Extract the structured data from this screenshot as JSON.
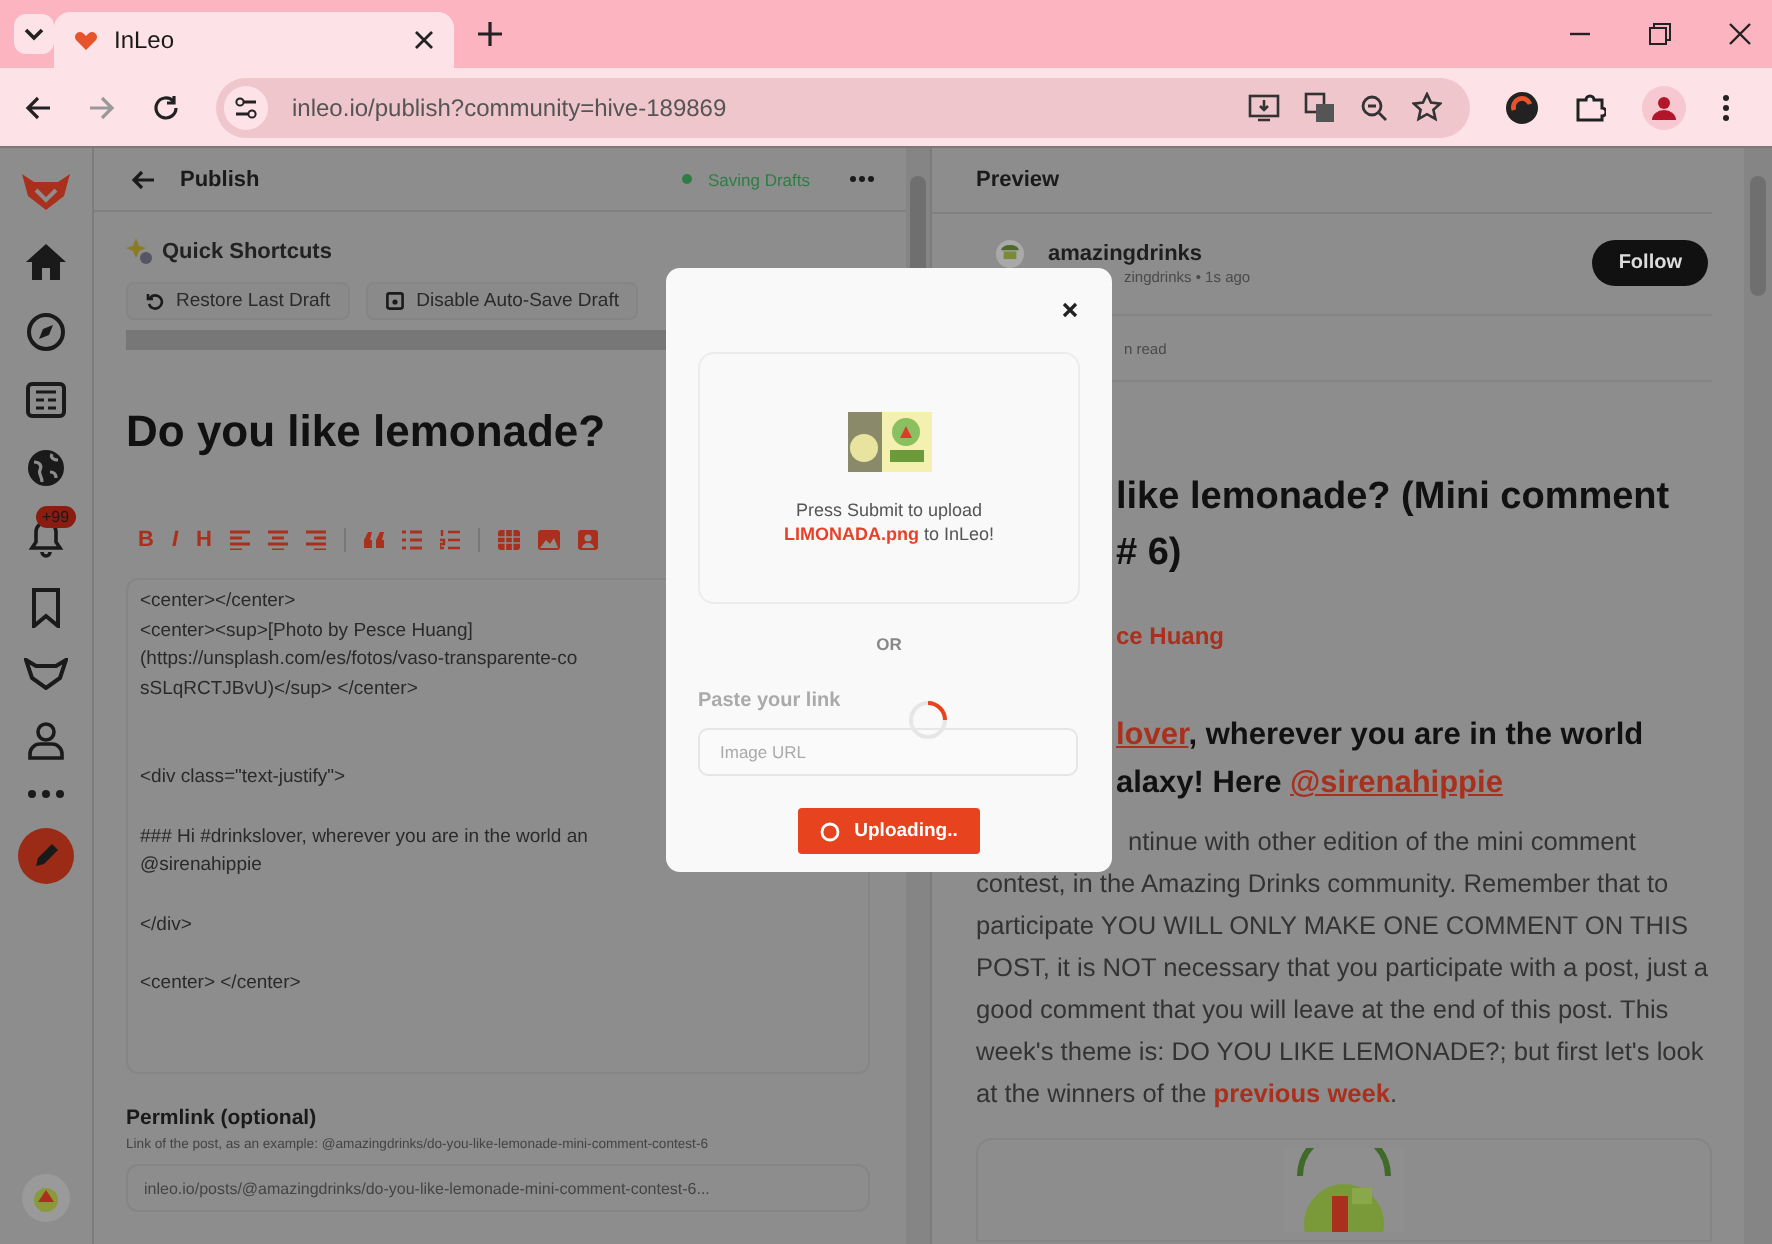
{
  "browser": {
    "tab_title": "InLeo",
    "url": "inleo.io/publish?community=hive-189869"
  },
  "sidebar": {
    "notification_badge": "+99"
  },
  "editor": {
    "title": "Publish",
    "status": "Saving Drafts",
    "shortcuts_title": "Quick Shortcuts",
    "shortcuts": [
      "Restore Last Draft",
      "Disable Auto-Save Draft"
    ],
    "post_title": "Do you like lemonade?",
    "format_buttons": [
      "B",
      "I",
      "H"
    ],
    "body_blocks": [
      [
        "<center></center>",
        "<center><sup>[Photo by Pesce Huang]",
        "(https://unsplash.com/es/fotos/vaso-transparente-co",
        "sSLqRCTJBvU)</sup> </center>"
      ],
      [
        "<div class=\"text-justify\">"
      ],
      [
        "### Hi #drinkslover, wherever you are in the world an",
        "@sirenahippie"
      ],
      [
        "</div>"
      ],
      [
        "<center> </center>"
      ]
    ],
    "permlink": {
      "label": "Permlink (optional)",
      "hint": "Link of the post, as an example: @amazingdrinks/do-you-like-lemonade-mini-comment-contest-6",
      "value": "inleo.io/posts/@amazingdrinks/do-you-like-lemonade-mini-comment-contest-6..."
    }
  },
  "preview": {
    "title": "Preview",
    "author": "amazingdrinks",
    "author_meta": "zingdrinks • 1s ago",
    "follow": "Follow",
    "read_time": "n read",
    "post_title_lines": [
      "like lemonade? (Mini comment",
      "# 6)"
    ],
    "photo_credit": "ce Huang",
    "heading_lines": [
      [
        {
          "text": "lover",
          "link": true
        },
        {
          "text": ", wherever you are in the world",
          "link": false
        }
      ],
      [
        {
          "text": "alaxy! Here ",
          "link": false
        },
        {
          "text": "@sirenahippie",
          "link": true
        }
      ]
    ],
    "paragraph": {
      "text": "ntinue with other edition of the mini comment contest, in the Amazing Drinks community. Remember that to participate YOU WILL ONLY MAKE ONE COMMENT ON THIS POST, it is NOT necessary that you participate with a post, just a good comment that you will leave at the end of this post. This week's theme is: DO YOU LIKE LEMONADE?; but first let's look at the winners of the ",
      "link": "previous week",
      "end": "."
    }
  },
  "modal": {
    "message": "Press Submit to upload",
    "file_line": "**LIMONADA.png** to InLeo!",
    "separator": "OR",
    "link_label": "Paste your link",
    "link_placeholder": "Image URL",
    "button": "Uploading..",
    "uploading": true
  }
}
